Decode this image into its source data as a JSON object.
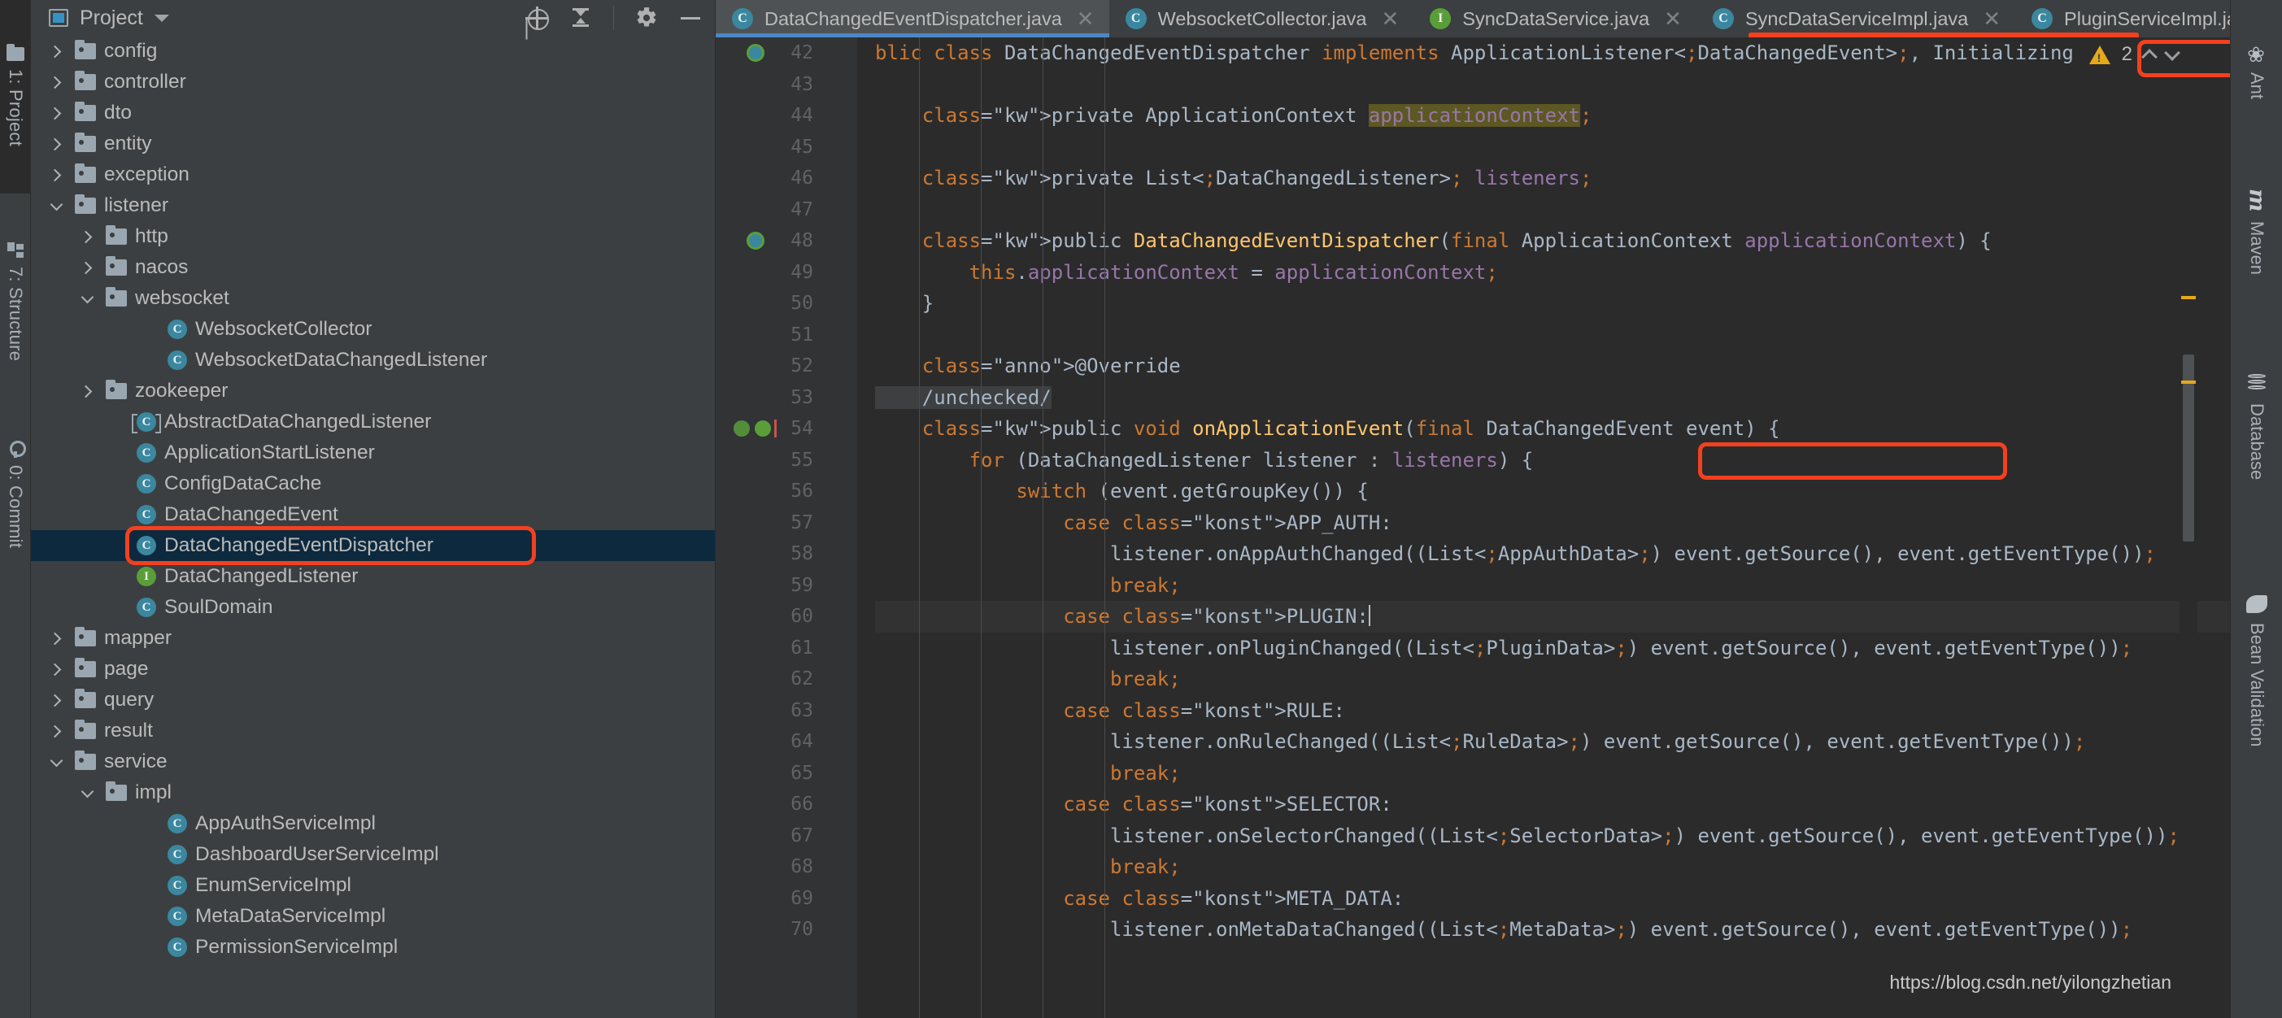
{
  "left_strip": {
    "items": [
      {
        "label": "1: Project",
        "icon": "folder-icon",
        "active": true
      },
      {
        "label": "7: Structure",
        "icon": "structure-icon",
        "active": false
      },
      {
        "label": "0: Commit",
        "icon": "commit-icon",
        "active": false
      }
    ]
  },
  "project_panel": {
    "title": "Project",
    "title_icon": "project-view-icon",
    "dropdown_icon": "chevron-down-icon",
    "toolbar": [
      {
        "name": "scroll-from-source-icon",
        "label": "Select Opened File"
      },
      {
        "name": "collapse-all-icon",
        "label": "Collapse All"
      },
      {
        "name": "gear-icon",
        "label": "Settings"
      },
      {
        "name": "hide-icon",
        "label": "Hide"
      }
    ],
    "tree": [
      {
        "label": "config",
        "type": "folder",
        "indent": 1,
        "state": "collapsed"
      },
      {
        "label": "controller",
        "type": "folder",
        "indent": 1,
        "state": "collapsed"
      },
      {
        "label": "dto",
        "type": "folder",
        "indent": 1,
        "state": "collapsed"
      },
      {
        "label": "entity",
        "type": "folder",
        "indent": 1,
        "state": "collapsed"
      },
      {
        "label": "exception",
        "type": "folder",
        "indent": 1,
        "state": "collapsed"
      },
      {
        "label": "listener",
        "type": "folder",
        "indent": 1,
        "state": "expanded"
      },
      {
        "label": "http",
        "type": "folder",
        "indent": 2,
        "state": "collapsed"
      },
      {
        "label": "nacos",
        "type": "folder",
        "indent": 2,
        "state": "collapsed"
      },
      {
        "label": "websocket",
        "type": "folder",
        "indent": 2,
        "state": "expanded"
      },
      {
        "label": "WebsocketCollector",
        "type": "class",
        "indent": 4,
        "state": "leaf"
      },
      {
        "label": "WebsocketDataChangedListener",
        "type": "class",
        "indent": 4,
        "state": "leaf"
      },
      {
        "label": "zookeeper",
        "type": "folder",
        "indent": 2,
        "state": "collapsed"
      },
      {
        "label": "AbstractDataChangedListener",
        "type": "abstract",
        "indent": 3,
        "state": "leaf"
      },
      {
        "label": "ApplicationStartListener",
        "type": "class",
        "indent": 3,
        "state": "leaf"
      },
      {
        "label": "ConfigDataCache",
        "type": "class",
        "indent": 3,
        "state": "leaf"
      },
      {
        "label": "DataChangedEvent",
        "type": "class",
        "indent": 3,
        "state": "leaf"
      },
      {
        "label": "DataChangedEventDispatcher",
        "type": "class",
        "indent": 3,
        "state": "leaf",
        "selected": true,
        "annotated": true
      },
      {
        "label": "DataChangedListener",
        "type": "interface",
        "indent": 3,
        "state": "leaf"
      },
      {
        "label": "SoulDomain",
        "type": "class",
        "indent": 3,
        "state": "leaf"
      },
      {
        "label": "mapper",
        "type": "folder",
        "indent": 1,
        "state": "collapsed"
      },
      {
        "label": "page",
        "type": "folder",
        "indent": 1,
        "state": "collapsed"
      },
      {
        "label": "query",
        "type": "folder",
        "indent": 1,
        "state": "collapsed"
      },
      {
        "label": "result",
        "type": "folder",
        "indent": 1,
        "state": "collapsed"
      },
      {
        "label": "service",
        "type": "folder",
        "indent": 1,
        "state": "expanded"
      },
      {
        "label": "impl",
        "type": "folder",
        "indent": 2,
        "state": "expanded"
      },
      {
        "label": "AppAuthServiceImpl",
        "type": "class",
        "indent": 4,
        "state": "leaf"
      },
      {
        "label": "DashboardUserServiceImpl",
        "type": "class",
        "indent": 4,
        "state": "leaf"
      },
      {
        "label": "EnumServiceImpl",
        "type": "class",
        "indent": 4,
        "state": "leaf"
      },
      {
        "label": "MetaDataServiceImpl",
        "type": "class",
        "indent": 4,
        "state": "leaf"
      },
      {
        "label": "PermissionServiceImpl",
        "type": "class",
        "indent": 4,
        "state": "leaf"
      }
    ]
  },
  "editor": {
    "tabs": [
      {
        "label": "DataChangedEventDispatcher.java",
        "icon": "class-icon",
        "active": true,
        "close_icon": "close-icon"
      },
      {
        "label": "WebsocketCollector.java",
        "icon": "class-icon",
        "active": false,
        "close_icon": "close-icon"
      },
      {
        "label": "SyncDataService.java",
        "icon": "interface-icon",
        "active": false,
        "close_icon": "close-icon"
      },
      {
        "label": "SyncDataServiceImpl.java",
        "icon": "class-icon",
        "active": false,
        "close_icon": "close-icon"
      },
      {
        "label": "PluginServiceImpl.java",
        "icon": "class-icon",
        "active": false,
        "close_icon": "chevron-right-icon"
      }
    ],
    "tab_overflow_icon": "chevron-down-icon",
    "inspection": {
      "warning_icon": "warning-triangle-icon",
      "warning_count": "2",
      "prev_icon": "chevron-up-icon",
      "next_icon": "chevron-down-icon"
    },
    "line_numbers": [
      "42",
      "43",
      "44",
      "45",
      "46",
      "47",
      "48",
      "49",
      "50",
      "51",
      "52",
      "53",
      "54",
      "55",
      "56",
      "57",
      "58",
      "59",
      "60",
      "61",
      "62",
      "63",
      "64",
      "65",
      "66",
      "67",
      "68",
      "69",
      "70"
    ],
    "lines": [
      "blic class DataChangedEventDispatcher implements ApplicationListener<DataChangedEvent>, Initializing",
      "",
      "    private ApplicationContext applicationContext;",
      "",
      "    private List<DataChangedListener> listeners;",
      "",
      "    public DataChangedEventDispatcher(final ApplicationContext applicationContext) {",
      "        this.applicationContext = applicationContext;",
      "    }",
      "",
      "    @Override",
      "    /unchecked/",
      "    public void onApplicationEvent(final DataChangedEvent event) {",
      "        for (DataChangedListener listener : listeners) {",
      "            switch (event.getGroupKey()) {",
      "                case APP_AUTH:",
      "                    listener.onAppAuthChanged((List<AppAuthData>) event.getSource(), event.getEventType());",
      "                    break;",
      "                case PLUGIN:",
      "                    listener.onPluginChanged((List<PluginData>) event.getSource(), event.getEventType());",
      "                    break;",
      "                case RULE:",
      "                    listener.onRuleChanged((List<RuleData>) event.getSource(), event.getEventType());",
      "                    break;",
      "                case SELECTOR:",
      "                    listener.onSelectorChanged((List<SelectorData>) event.getSource(), event.getEventType());",
      "                    break;",
      "                case META_DATA:",
      "                    listener.onMetaDataChanged((List<MetaData>) event.getSource(), event.getEventType());"
    ],
    "current_line_number": "60",
    "highlighted_field": "applicationContext"
  },
  "right_strip": {
    "items": [
      {
        "label": "Ant",
        "icon": "ant-icon"
      },
      {
        "label": "Maven",
        "icon": "maven-icon"
      },
      {
        "label": "Database",
        "icon": "database-icon"
      },
      {
        "label": "Bean Validation",
        "icon": "bean-validation-icon"
      }
    ]
  },
  "watermark": "https://blog.csdn.net/yilongzhetian",
  "colors": {
    "accent_blue": "#4a88c7",
    "annotation_red": "#f4401f",
    "selection_navy": "#0d293e",
    "editor_bg": "#2b2b2b",
    "panel_bg": "#3c3f41",
    "keyword_orange": "#cc7832",
    "field_purple": "#9876aa",
    "method_yellow": "#ffc66d",
    "annotation_olive": "#bbb529",
    "text_default": "#a9b7c6",
    "class_icon_teal": "#3b879f",
    "interface_icon_green": "#5a9e3a",
    "warning_amber": "#e5a91a"
  }
}
